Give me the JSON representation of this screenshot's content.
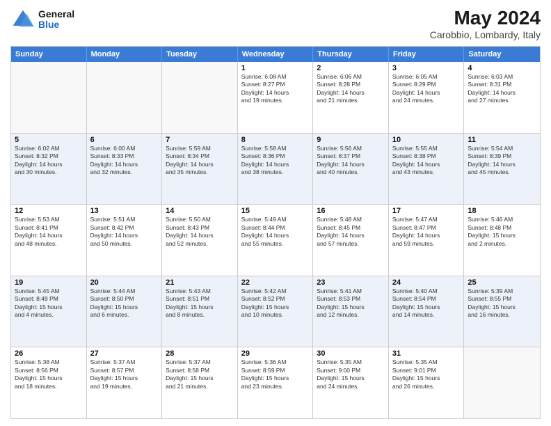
{
  "header": {
    "logo_line1": "General",
    "logo_line2": "Blue",
    "title": "May 2024",
    "subtitle": "Carobbio, Lombardy, Italy"
  },
  "calendar": {
    "days": [
      "Sunday",
      "Monday",
      "Tuesday",
      "Wednesday",
      "Thursday",
      "Friday",
      "Saturday"
    ],
    "rows": [
      {
        "alt": false,
        "cells": [
          {
            "day": "",
            "info": ""
          },
          {
            "day": "",
            "info": ""
          },
          {
            "day": "",
            "info": ""
          },
          {
            "day": "1",
            "info": "Sunrise: 6:08 AM\nSunset: 8:27 PM\nDaylight: 14 hours\nand 19 minutes."
          },
          {
            "day": "2",
            "info": "Sunrise: 6:06 AM\nSunset: 8:28 PM\nDaylight: 14 hours\nand 21 minutes."
          },
          {
            "day": "3",
            "info": "Sunrise: 6:05 AM\nSunset: 8:29 PM\nDaylight: 14 hours\nand 24 minutes."
          },
          {
            "day": "4",
            "info": "Sunrise: 6:03 AM\nSunset: 8:31 PM\nDaylight: 14 hours\nand 27 minutes."
          }
        ]
      },
      {
        "alt": true,
        "cells": [
          {
            "day": "5",
            "info": "Sunrise: 6:02 AM\nSunset: 8:32 PM\nDaylight: 14 hours\nand 30 minutes."
          },
          {
            "day": "6",
            "info": "Sunrise: 6:00 AM\nSunset: 8:33 PM\nDaylight: 14 hours\nand 32 minutes."
          },
          {
            "day": "7",
            "info": "Sunrise: 5:59 AM\nSunset: 8:34 PM\nDaylight: 14 hours\nand 35 minutes."
          },
          {
            "day": "8",
            "info": "Sunrise: 5:58 AM\nSunset: 8:36 PM\nDaylight: 14 hours\nand 38 minutes."
          },
          {
            "day": "9",
            "info": "Sunrise: 5:56 AM\nSunset: 8:37 PM\nDaylight: 14 hours\nand 40 minutes."
          },
          {
            "day": "10",
            "info": "Sunrise: 5:55 AM\nSunset: 8:38 PM\nDaylight: 14 hours\nand 43 minutes."
          },
          {
            "day": "11",
            "info": "Sunrise: 5:54 AM\nSunset: 8:39 PM\nDaylight: 14 hours\nand 45 minutes."
          }
        ]
      },
      {
        "alt": false,
        "cells": [
          {
            "day": "12",
            "info": "Sunrise: 5:53 AM\nSunset: 8:41 PM\nDaylight: 14 hours\nand 48 minutes."
          },
          {
            "day": "13",
            "info": "Sunrise: 5:51 AM\nSunset: 8:42 PM\nDaylight: 14 hours\nand 50 minutes."
          },
          {
            "day": "14",
            "info": "Sunrise: 5:50 AM\nSunset: 8:43 PM\nDaylight: 14 hours\nand 52 minutes."
          },
          {
            "day": "15",
            "info": "Sunrise: 5:49 AM\nSunset: 8:44 PM\nDaylight: 14 hours\nand 55 minutes."
          },
          {
            "day": "16",
            "info": "Sunrise: 5:48 AM\nSunset: 8:45 PM\nDaylight: 14 hours\nand 57 minutes."
          },
          {
            "day": "17",
            "info": "Sunrise: 5:47 AM\nSunset: 8:47 PM\nDaylight: 14 hours\nand 59 minutes."
          },
          {
            "day": "18",
            "info": "Sunrise: 5:46 AM\nSunset: 8:48 PM\nDaylight: 15 hours\nand 2 minutes."
          }
        ]
      },
      {
        "alt": true,
        "cells": [
          {
            "day": "19",
            "info": "Sunrise: 5:45 AM\nSunset: 8:49 PM\nDaylight: 15 hours\nand 4 minutes."
          },
          {
            "day": "20",
            "info": "Sunrise: 5:44 AM\nSunset: 8:50 PM\nDaylight: 15 hours\nand 6 minutes."
          },
          {
            "day": "21",
            "info": "Sunrise: 5:43 AM\nSunset: 8:51 PM\nDaylight: 15 hours\nand 8 minutes."
          },
          {
            "day": "22",
            "info": "Sunrise: 5:42 AM\nSunset: 8:52 PM\nDaylight: 15 hours\nand 10 minutes."
          },
          {
            "day": "23",
            "info": "Sunrise: 5:41 AM\nSunset: 8:53 PM\nDaylight: 15 hours\nand 12 minutes."
          },
          {
            "day": "24",
            "info": "Sunrise: 5:40 AM\nSunset: 8:54 PM\nDaylight: 15 hours\nand 14 minutes."
          },
          {
            "day": "25",
            "info": "Sunrise: 5:39 AM\nSunset: 8:55 PM\nDaylight: 15 hours\nand 16 minutes."
          }
        ]
      },
      {
        "alt": false,
        "cells": [
          {
            "day": "26",
            "info": "Sunrise: 5:38 AM\nSunset: 8:56 PM\nDaylight: 15 hours\nand 18 minutes."
          },
          {
            "day": "27",
            "info": "Sunrise: 5:37 AM\nSunset: 8:57 PM\nDaylight: 15 hours\nand 19 minutes."
          },
          {
            "day": "28",
            "info": "Sunrise: 5:37 AM\nSunset: 8:58 PM\nDaylight: 15 hours\nand 21 minutes."
          },
          {
            "day": "29",
            "info": "Sunrise: 5:36 AM\nSunset: 8:59 PM\nDaylight: 15 hours\nand 23 minutes."
          },
          {
            "day": "30",
            "info": "Sunrise: 5:35 AM\nSunset: 9:00 PM\nDaylight: 15 hours\nand 24 minutes."
          },
          {
            "day": "31",
            "info": "Sunrise: 5:35 AM\nSunset: 9:01 PM\nDaylight: 15 hours\nand 26 minutes."
          },
          {
            "day": "",
            "info": ""
          }
        ]
      }
    ]
  }
}
